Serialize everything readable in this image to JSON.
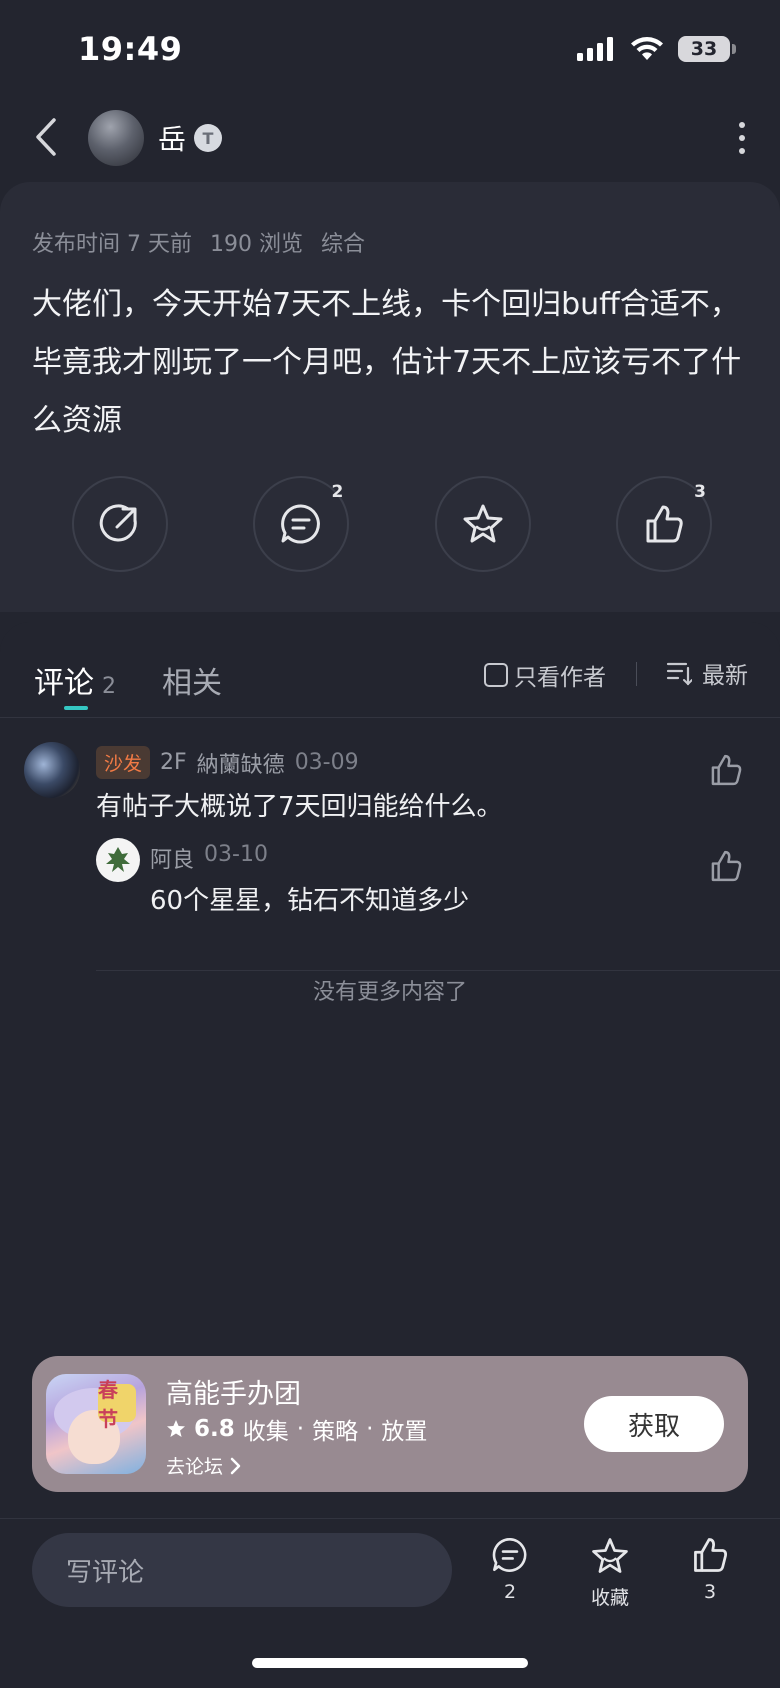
{
  "status_bar": {
    "time": "19:49",
    "battery": "33"
  },
  "author": {
    "name": "岳",
    "badge": "T"
  },
  "post": {
    "published": "发布时间 7 天前",
    "views": "190 浏览",
    "category": "综合",
    "body": "大佬们，今天开始7天不上线，卡个回归buff合适不，毕竟我才刚玩了一个月吧，估计7天不上应该亏不了什么资源",
    "actions": {
      "comment_count": "2",
      "like_count": "3"
    }
  },
  "tabs": {
    "comments_label": "评论",
    "comments_count": "2",
    "related_label": "相关",
    "author_only": "只看作者",
    "sort": "最新"
  },
  "comment": {
    "badge": "沙发",
    "floor": "2F",
    "user": "納蘭缺德",
    "date": "03-09",
    "text": "有帖子大概说了7天回归能给什么。",
    "reply": {
      "user": "阿良",
      "date": "03-10",
      "text": "60个星星，钻石不知道多少"
    }
  },
  "no_more": "没有更多内容了",
  "game": {
    "icon_tag": "春节",
    "name": "高能手办团",
    "score": "6.8",
    "tags": [
      "收集",
      "策略",
      "放置"
    ],
    "forum_link": "去论坛",
    "get_button": "获取"
  },
  "bottom_bar": {
    "placeholder": "写评论",
    "comment_count": "2",
    "favorite_label": "收藏",
    "like_count": "3"
  }
}
